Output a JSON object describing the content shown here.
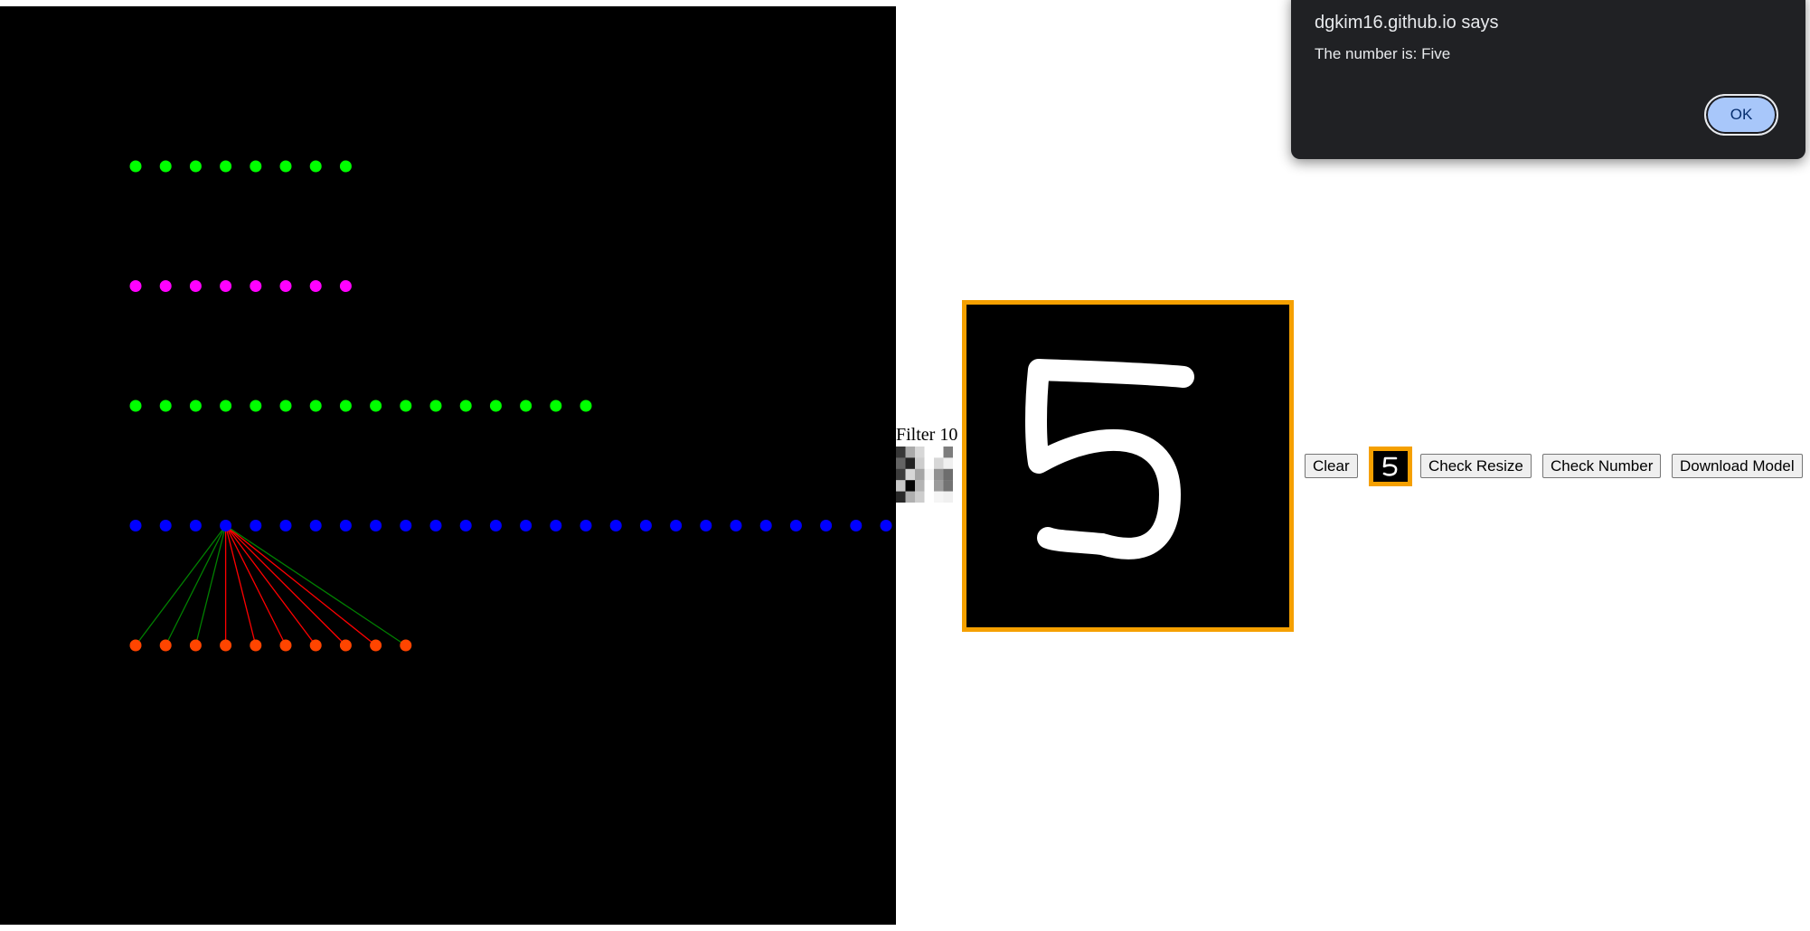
{
  "network": {
    "layers": [
      {
        "name": "layer-1",
        "color": "#00ff00",
        "count": 8
      },
      {
        "name": "layer-2",
        "color": "#ff00ff",
        "count": 8
      },
      {
        "name": "layer-3",
        "color": "#00ff00",
        "count": 16
      },
      {
        "name": "layer-4",
        "color": "#0000ff",
        "count": 27
      },
      {
        "name": "output",
        "color": "#ff4500",
        "count": 10
      }
    ],
    "highlighted_source_index": 3,
    "connection_colors": [
      "#008000",
      "#008000",
      "#008000",
      "#ff0000",
      "#ff0000",
      "#ff0000",
      "#ff0000",
      "#ff0000",
      "#ff0000",
      "#008000"
    ]
  },
  "filter": {
    "label": "Filter 10",
    "grayscale": [
      [
        55,
        170,
        215,
        255,
        255,
        125
      ],
      [
        100,
        35,
        205,
        255,
        215,
        240
      ],
      [
        60,
        215,
        165,
        245,
        145,
        110
      ],
      [
        200,
        5,
        180,
        255,
        155,
        115
      ],
      [
        40,
        175,
        205,
        255,
        245,
        240
      ]
    ]
  },
  "drawing": {
    "digit": "5",
    "stroke_color": "#ffffff",
    "border_color": "#f5a000"
  },
  "buttons": {
    "clear": "Clear",
    "check_resize": "Check Resize",
    "check_number": "Check Number",
    "download_model": "Download Model"
  },
  "preview": {
    "digit": "5"
  },
  "dialog": {
    "title": "dgkim16.github.io says",
    "message": "The number is: Five",
    "ok_label": "OK"
  }
}
